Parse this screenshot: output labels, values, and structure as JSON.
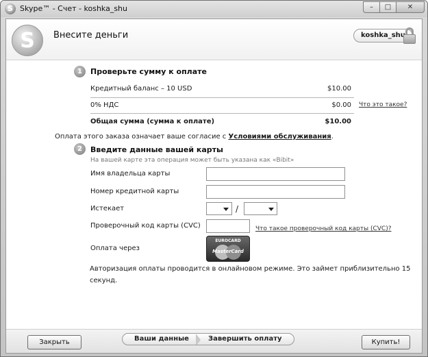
{
  "window": {
    "title": "Skype™ - Счет - koshka_shu",
    "minimize_glyph": "–",
    "maximize_glyph": "□",
    "close_glyph": "✕"
  },
  "header": {
    "logo_letter": "S",
    "title": "Внесите деньги",
    "username": "koshka_shu",
    "icons": [
      "skype-logo-icon",
      "lock-icon"
    ]
  },
  "step1": {
    "number": "1",
    "title": "Проверьте сумму к оплате",
    "items": [
      {
        "label": "Кредитный баланс – 10 USD",
        "amount": "$10.00"
      },
      {
        "label": "0% НДС",
        "amount": "$0.00",
        "link": "Что это такое?"
      }
    ],
    "total_label": "Общая сумма (сумма к оплате)",
    "total_amount": "$10.00"
  },
  "agreement": {
    "text": "Оплата этого заказа означает ваше согласие с ",
    "link": "Условиями обслуживания",
    "suffix": "."
  },
  "step2": {
    "number": "2",
    "title": "Введите данные вашей карты",
    "hint": "На вашей карте эта операция может быть указана как «Bibit»",
    "cardholder_label": "Имя владельца карты",
    "cardholder_value": "",
    "card_number_label": "Номер кредитной карты",
    "card_number_value": "",
    "expires_label": "Истекает",
    "expires_month": "",
    "expires_year": "",
    "expires_separator": "/",
    "cvc_label": "Проверочный код карты (CVC)",
    "cvc_value": "",
    "cvc_link": "Что такое проверочный код карты (CVC)?",
    "pay_via_label": "Оплата через",
    "card_top_text": "EUROCARD",
    "card_brand_text": "MasterCard",
    "info_text": "Авторизация оплаты проводится в онлайновом режиме. Это займет приблизительно 15 секунд."
  },
  "footer": {
    "close_button": "Закрыть",
    "crumb_1": "Ваши данные",
    "crumb_2": "Завершить оплату",
    "buy_button": "Купить!"
  }
}
